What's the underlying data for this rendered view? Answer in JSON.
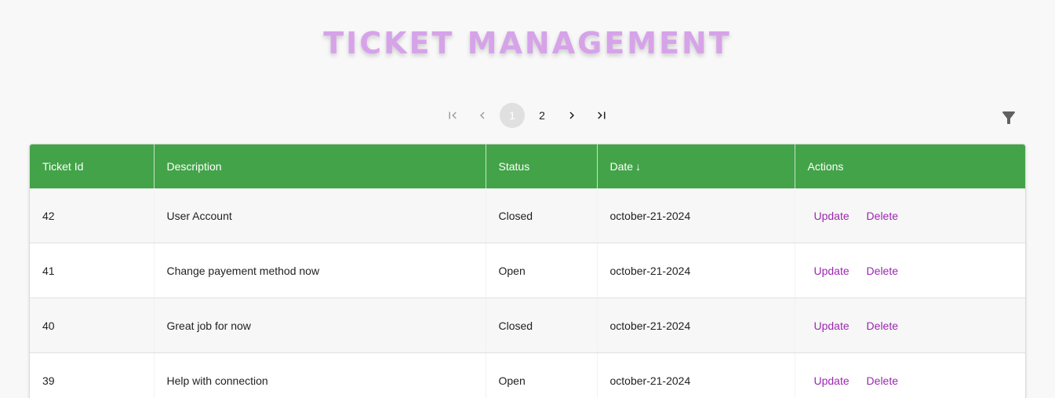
{
  "page": {
    "title": "TICKET MANAGEMENT"
  },
  "pagination": {
    "first_icon": "first-page-icon",
    "prev_icon": "chevron-left-icon",
    "pages": [
      "1",
      "2"
    ],
    "current_page": "1",
    "next_icon": "chevron-right-icon",
    "last_icon": "last-page-icon"
  },
  "toolbar": {
    "filter_icon": "filter-icon"
  },
  "table": {
    "headers": {
      "id": "Ticket Id",
      "description": "Description",
      "status": "Status",
      "date": "Date",
      "date_sort_indicator": "↓",
      "actions": "Actions"
    },
    "header_color": "#43a348",
    "rows": [
      {
        "id": "42",
        "description": "User Account",
        "status": "Closed",
        "date": "october-21-2024",
        "update": "Update",
        "delete": "Delete"
      },
      {
        "id": "41",
        "description": "Change payement method now",
        "status": "Open",
        "date": "october-21-2024",
        "update": "Update",
        "delete": "Delete"
      },
      {
        "id": "40",
        "description": "Great job for now",
        "status": "Closed",
        "date": "october-21-2024",
        "update": "Update",
        "delete": "Delete"
      },
      {
        "id": "39",
        "description": "Help with connection",
        "status": "Open",
        "date": "october-21-2024",
        "update": "Update",
        "delete": "Delete"
      }
    ]
  },
  "colors": {
    "title": "#d6a3e9",
    "action_link": "#9c27b0"
  }
}
